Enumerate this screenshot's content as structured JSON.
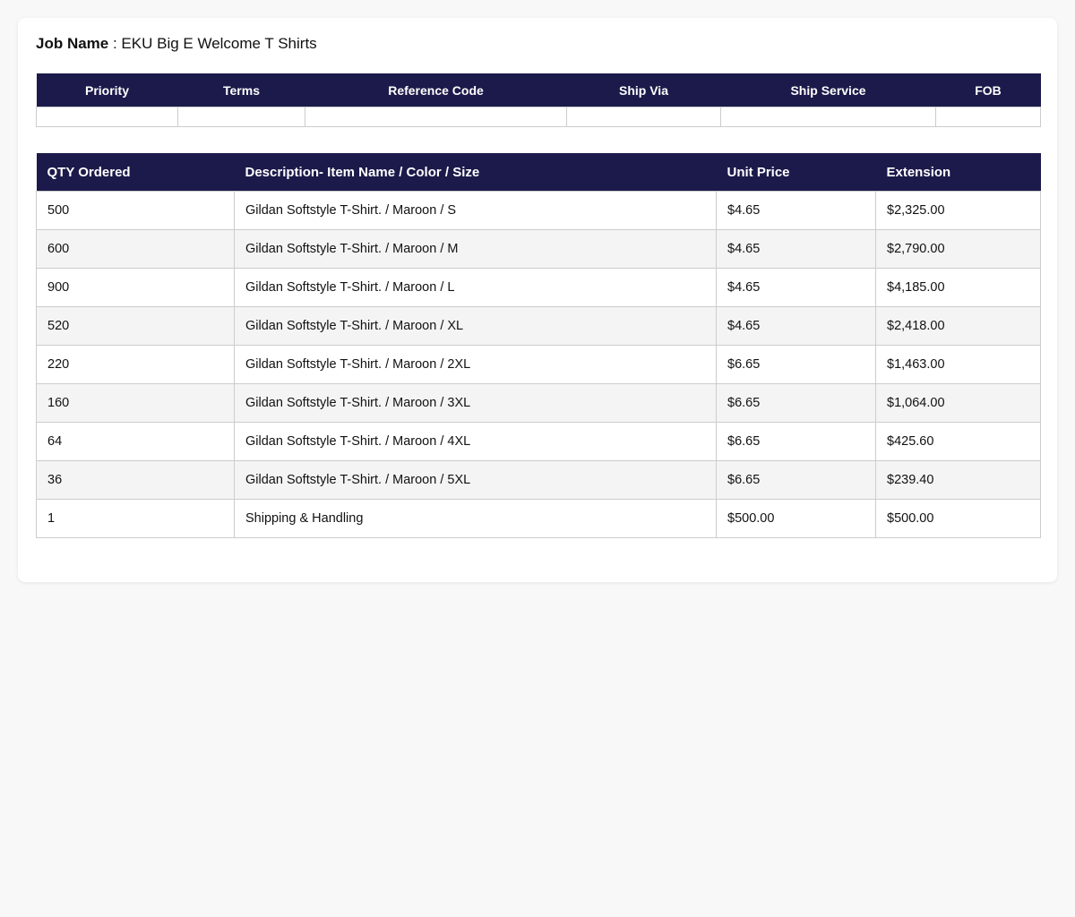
{
  "job": {
    "label": "Job Name",
    "separator": " : ",
    "name": "EKU Big E Welcome T Shirts"
  },
  "meta_table": {
    "headers": [
      "Priority",
      "Terms",
      "Reference Code",
      "Ship Via",
      "Ship Service",
      "FOB"
    ],
    "values": [
      "",
      "",
      "",
      "",
      "",
      ""
    ]
  },
  "items_table": {
    "headers": [
      "QTY Ordered",
      "Description- Item Name / Color / Size",
      "Unit Price",
      "Extension"
    ],
    "rows": [
      [
        "500",
        "Gildan Softstyle T-Shirt. / Maroon / S",
        "$4.65",
        "$2,325.00"
      ],
      [
        "600",
        "Gildan Softstyle T-Shirt. / Maroon / M",
        "$4.65",
        "$2,790.00"
      ],
      [
        "900",
        "Gildan Softstyle T-Shirt. / Maroon / L",
        "$4.65",
        "$4,185.00"
      ],
      [
        "520",
        "Gildan Softstyle T-Shirt. / Maroon / XL",
        "$4.65",
        "$2,418.00"
      ],
      [
        "220",
        "Gildan Softstyle T-Shirt. / Maroon / 2XL",
        "$6.65",
        "$1,463.00"
      ],
      [
        "160",
        "Gildan Softstyle T-Shirt. / Maroon / 3XL",
        "$6.65",
        "$1,064.00"
      ],
      [
        "64",
        "Gildan Softstyle T-Shirt. / Maroon / 4XL",
        "$6.65",
        "$425.60"
      ],
      [
        "36",
        "Gildan Softstyle T-Shirt. / Maroon / 5XL",
        "$6.65",
        "$239.40"
      ],
      [
        "1",
        "Shipping & Handling",
        "$500.00",
        "$500.00"
      ]
    ]
  },
  "colors": {
    "header_bg": "#1b1a4a",
    "header_text": "#ffffff",
    "page_bg": "#f8f8f8",
    "row_alt_bg": "#f4f4f4"
  }
}
